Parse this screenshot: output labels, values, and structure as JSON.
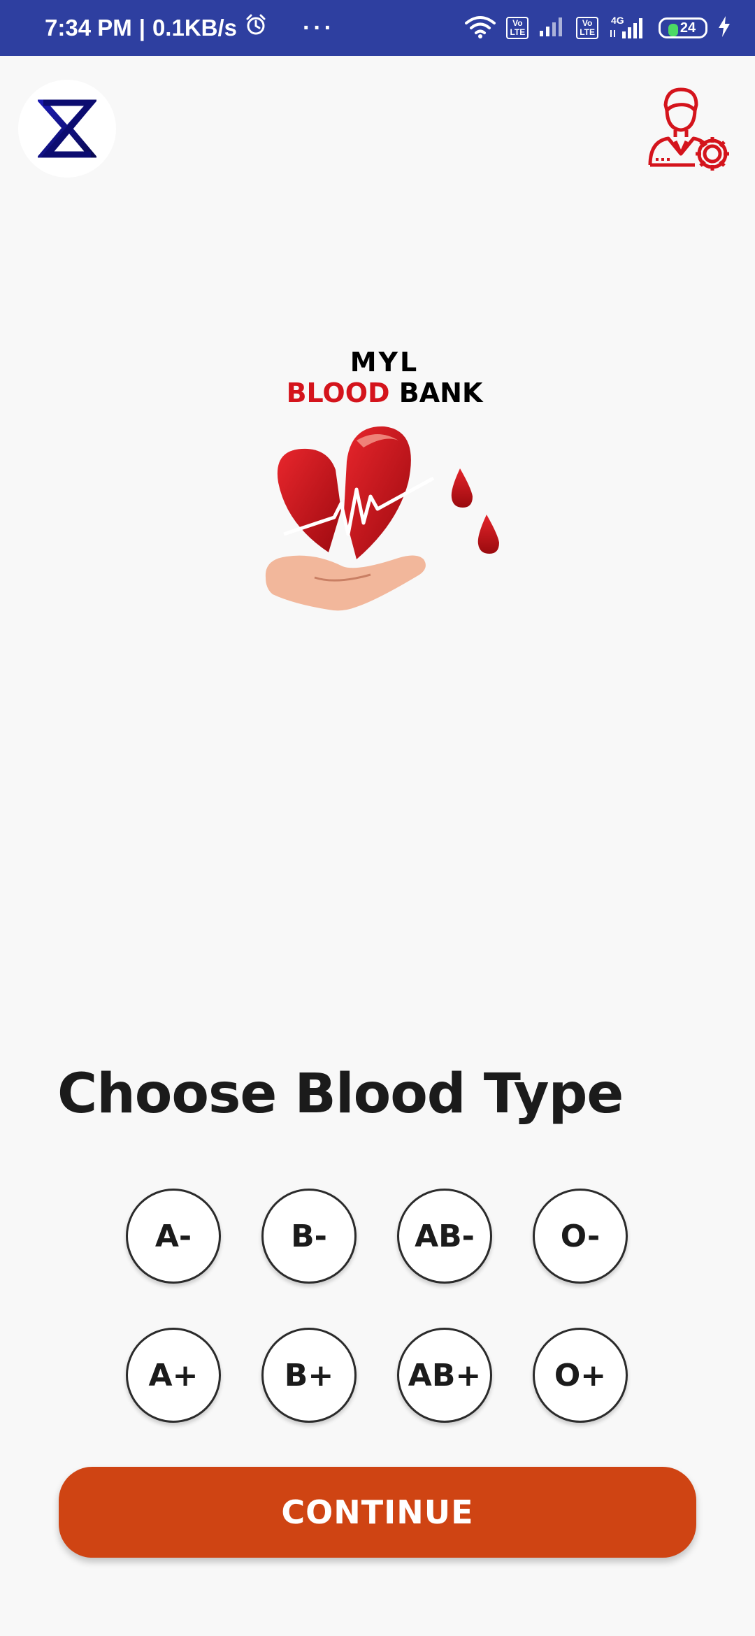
{
  "status_bar": {
    "time": "7:34 PM",
    "network_speed": "0.1KB/s",
    "more": "···",
    "volte1": "Vo\nLTE",
    "volte2": "Vo\nLTE",
    "net_type": "4G",
    "battery": "24",
    "colors": {
      "background": "#2e3fa0",
      "battery_fill": "#4cd964"
    }
  },
  "header": {
    "app_icon": "hourglass-z-logo-icon",
    "settings_icon": "user-settings-icon"
  },
  "brand": {
    "line1": "MYL",
    "blood": "BLOOD",
    "bank": "BANK",
    "art_icon": "heart-hand-blood-drops-icon",
    "colors": {
      "blood": "#d4141c",
      "heart": "#d4141c",
      "hand": "#f2b79b"
    }
  },
  "main": {
    "heading": "Choose Blood Type",
    "blood_types": [
      "A-",
      "B-",
      "AB-",
      "O-",
      "A+",
      "B+",
      "AB+",
      "O+"
    ],
    "continue_label": "CONTINUE",
    "colors": {
      "continue": "#cf4413"
    }
  }
}
